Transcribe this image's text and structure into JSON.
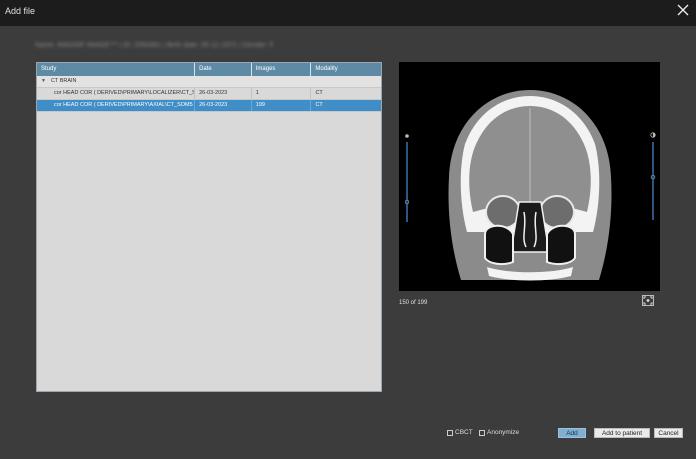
{
  "window": {
    "title": "Add file"
  },
  "patient_info": "Name: MAGNIF IMAGE***   |   ID: 2050461   |   Birth date: 05-12-1972   |   Gender: F",
  "table": {
    "headers": {
      "study": "Study",
      "date": "Date",
      "images": "Images",
      "modality": "Modality"
    },
    "group": {
      "label": "CT BRAIN"
    },
    "rows": [
      {
        "study": "cor HEAD COR ( DERIVED\\PRIMARY\\LOCALIZER\\CT_SOM...",
        "date": "26-03-2023",
        "images": "1",
        "modality": "CT"
      },
      {
        "study": "cor HEAD COR ( DERIVED\\PRIMARY\\AXIAL\\CT_SOM5 MP...",
        "date": "26-03-2023",
        "images": "199",
        "modality": "CT"
      }
    ]
  },
  "viewer": {
    "slice_label": "150 of 199",
    "current_slice": 150,
    "total_slices": 199,
    "left_slider_level": 0.25,
    "right_slider_level": 0.55
  },
  "options": {
    "cbct_label": "CBCT",
    "anonymize_label": "Anonymize"
  },
  "buttons": {
    "add": "Add",
    "add_to_patient": "Add to patient",
    "cancel": "Cancel"
  },
  "colors": {
    "accent": "#3f8ec7",
    "header": "#5e8aa6",
    "slider": "#4a90d0"
  }
}
